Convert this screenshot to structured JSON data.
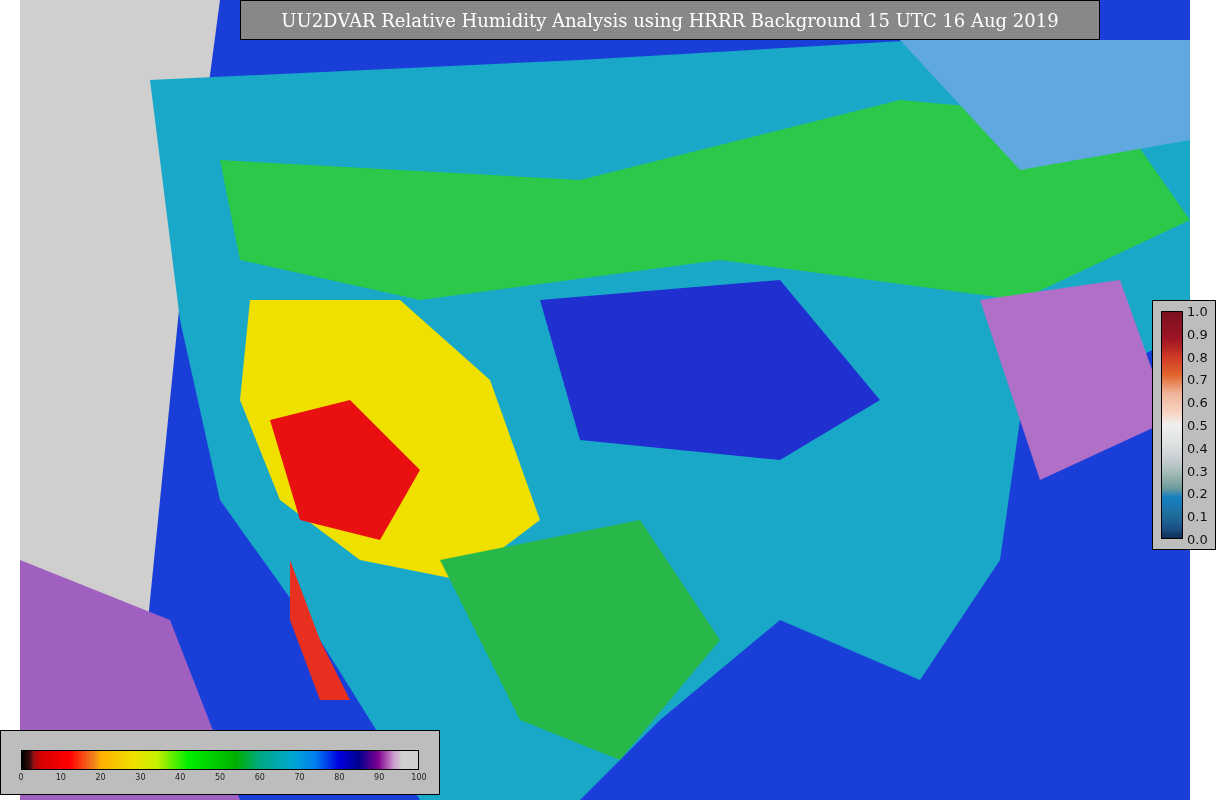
{
  "title": "UU2DVAR Relative Humidity Analysis using HRRR Background 15 UTC 16 Aug 2019",
  "ratio_colorbar": {
    "ticks": [
      "1.0",
      "0.9",
      "0.8",
      "0.7",
      "0.6",
      "0.5",
      "0.4",
      "0.3",
      "0.2",
      "0.1",
      "0.0"
    ]
  },
  "humidity_colorbar": {
    "ticks": [
      "0",
      "10",
      "20",
      "30",
      "40",
      "50",
      "60",
      "70",
      "80",
      "90",
      "100"
    ]
  }
}
